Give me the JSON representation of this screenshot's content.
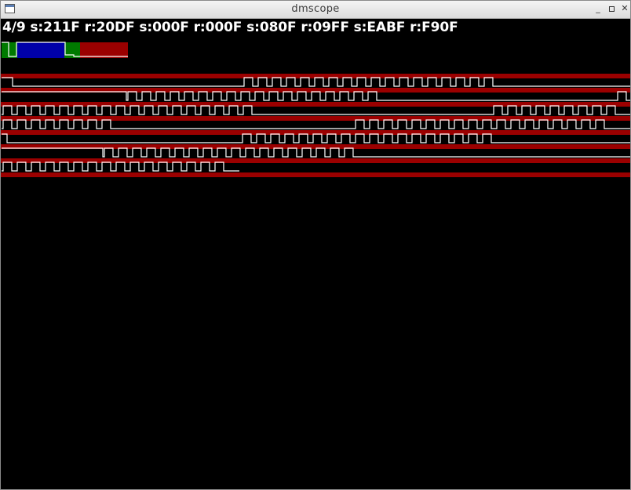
{
  "window": {
    "title": "dmscope",
    "controls": [
      "minimize-icon",
      "maximize-icon",
      "close-icon"
    ]
  },
  "status": {
    "text": "4/9 s:211F r:20DF s:000F r:000F s:080F r:09FF s:EABF r:F90F"
  },
  "colors": {
    "background": "#000000",
    "trace": "#ffffff",
    "band": "#9b0000",
    "green": "#007a00",
    "blue": "#0000a8"
  }
}
